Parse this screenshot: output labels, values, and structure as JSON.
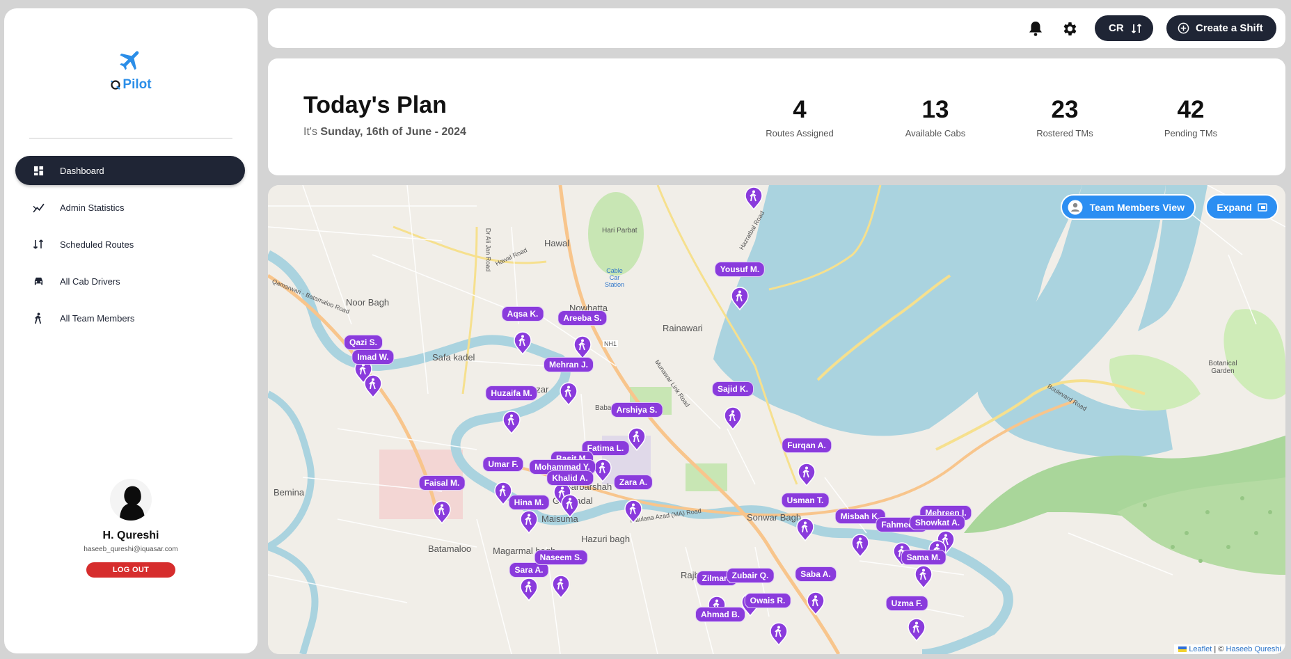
{
  "app": {
    "name": "Pilot"
  },
  "sidebar": {
    "items": [
      {
        "label": "Dashboard",
        "icon": "dashboard-icon",
        "active": true
      },
      {
        "label": "Admin Statistics",
        "icon": "chart-icon",
        "active": false
      },
      {
        "label": "Scheduled Routes",
        "icon": "routes-icon",
        "active": false
      },
      {
        "label": "All Cab Drivers",
        "icon": "car-icon",
        "active": false
      },
      {
        "label": "All Team Members",
        "icon": "walker-icon",
        "active": false
      }
    ]
  },
  "profile": {
    "name": "H. Qureshi",
    "email": "haseeb_qureshi@iquasar.com",
    "logout_label": "LOG OUT"
  },
  "header": {
    "user_initials": "CR",
    "create_shift_label": "Create a Shift"
  },
  "plan": {
    "title": "Today's Plan",
    "subtitle_prefix": "It's",
    "date": "Sunday, 16th of June - 2024",
    "stats": [
      {
        "value": "4",
        "label": "Routes Assigned"
      },
      {
        "value": "13",
        "label": "Available Cabs"
      },
      {
        "value": "23",
        "label": "Rostered TMs"
      },
      {
        "value": "42",
        "label": "Pending TMs"
      }
    ]
  },
  "map": {
    "view_button_label": "Team Members View",
    "expand_label": "Expand",
    "attribution_leaflet": "Leaflet",
    "attribution_sep": "|",
    "attribution_copy": "©",
    "attribution_author": "Haseeb Qureshi",
    "place_labels": [
      "Hawal",
      "Nowhatta",
      "Rainawari",
      "Noor Bagh",
      "Safa kadel",
      "Nawa bazar",
      "Barbarshah",
      "Gawkadal",
      "Maisuma",
      "Batamaloo",
      "Bemina",
      "Hazuri bagh",
      "Sonwar Bagh",
      "Rajbagh",
      "Magarmal bagh",
      "Botanical Garden",
      "Hari Parbat",
      "Cable Car Station",
      "Baba Demb",
      "NH1",
      "Boulevard Road",
      "Qamarwari - Batamaloo Road",
      "Maulana Azad (MA) Road",
      "Munawar Link Road",
      "Dr Ali Jan Road",
      "Hawal Road",
      "Hazratbal Road"
    ],
    "markers": [
      {
        "name": ""
      },
      {
        "name": "Yousuf M."
      },
      {
        "name": "Aqsa K."
      },
      {
        "name": "Areeba S."
      },
      {
        "name": "Qazi S."
      },
      {
        "name": "Imad W."
      },
      {
        "name": "Mehran J."
      },
      {
        "name": "Huzaifa M."
      },
      {
        "name": "Sajid K."
      },
      {
        "name": "Arshiya S."
      },
      {
        "name": "Fatima L."
      },
      {
        "name": "Basit M."
      },
      {
        "name": "Umar F."
      },
      {
        "name": "Mohammad Y."
      },
      {
        "name": "Khalid A."
      },
      {
        "name": "Faisal M."
      },
      {
        "name": "Hina M."
      },
      {
        "name": "Zara A."
      },
      {
        "name": "Furqan A."
      },
      {
        "name": "Usman T."
      },
      {
        "name": "Misbah K."
      },
      {
        "name": "Fahmeeda"
      },
      {
        "name": "Mehreen I."
      },
      {
        "name": "Showkat A."
      },
      {
        "name": "Sama M."
      },
      {
        "name": "Sara A."
      },
      {
        "name": "Naseem S."
      },
      {
        "name": "Zilmarij"
      },
      {
        "name": "Zubair Q."
      },
      {
        "name": "Saba A."
      },
      {
        "name": "Owais R."
      },
      {
        "name": "Uzma F."
      },
      {
        "name": "Ahmad B."
      }
    ]
  },
  "colors": {
    "accent": "#1f2535",
    "brand": "#2b8ee8",
    "marker": "#8a3bdc",
    "logout": "#d62d2d",
    "map_button": "#2b8ef2"
  }
}
